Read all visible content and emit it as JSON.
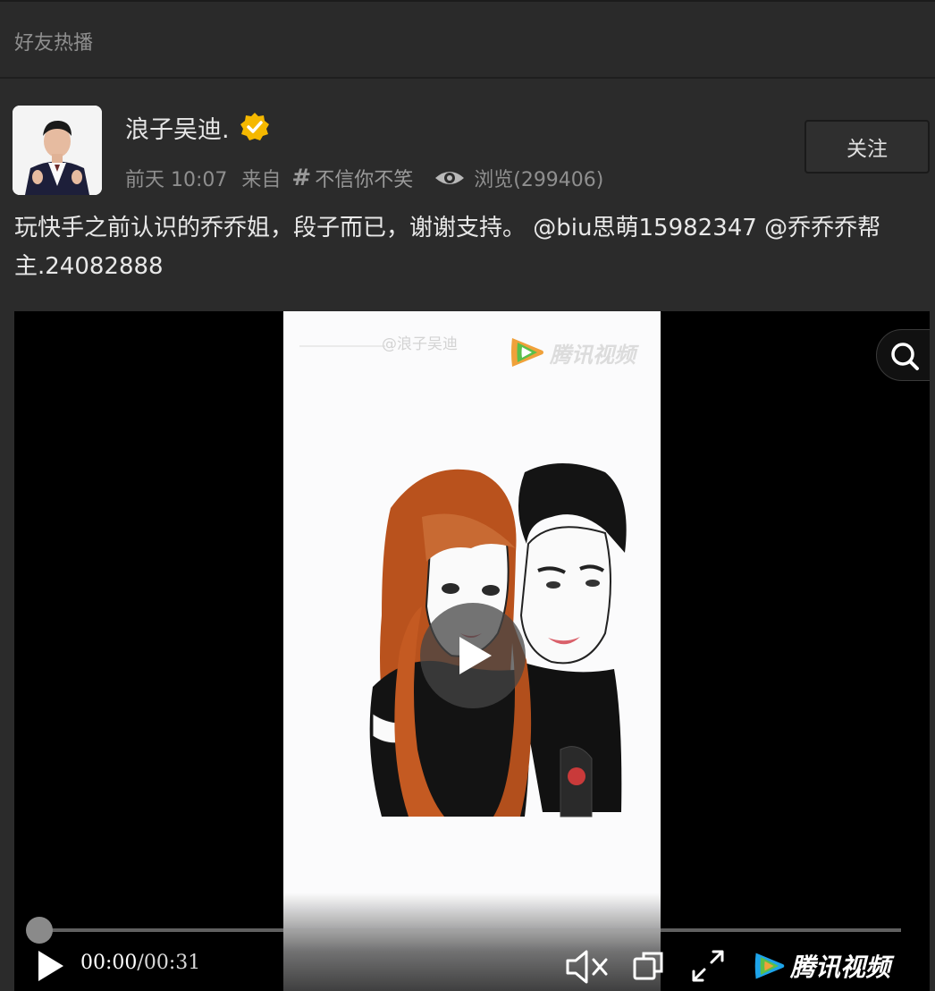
{
  "section": {
    "title": "好友热播"
  },
  "post": {
    "username": "浪子吴迪.",
    "time": "前天 10:07",
    "from_label": "来自",
    "topic": "不信你不笑",
    "views": "浏览(299406)",
    "follow_label": "关注",
    "text_main": "玩快手之前认识的乔乔姐，段子而已，谢谢支持。",
    "mention_1": "@biu思萌15982347",
    "mention_2": "@乔乔乔帮主.24082888"
  },
  "video": {
    "watermark_user": "@浪子吴迪",
    "watermark_brand": "腾讯视频",
    "current_time": "00:00",
    "total_time": "/00:31",
    "brand_label": "腾讯视频",
    "progress": 0.0,
    "muted": true
  },
  "colors": {
    "background": "#2b2b2b",
    "verified_badge": "#f5b800",
    "video_background": "#000000"
  },
  "icons": [
    "verified-icon",
    "hash-icon",
    "eye-icon",
    "search-icon",
    "play-icon",
    "mute-icon",
    "pip-icon",
    "fullscreen-icon",
    "tencent-video-logo-icon"
  ]
}
